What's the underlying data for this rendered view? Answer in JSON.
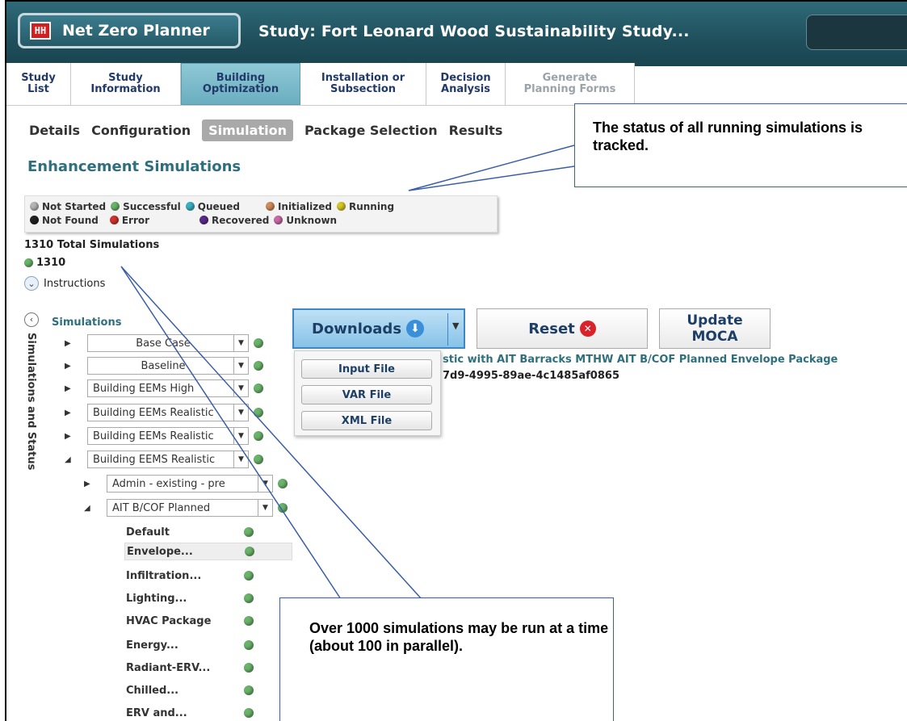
{
  "app": {
    "logo_text": "HH",
    "title": "Net Zero Planner",
    "study_title": "Study: Fort Leonard Wood Sustainability Study..."
  },
  "tabs": [
    {
      "line1": "Study",
      "line2": "List"
    },
    {
      "line1": "Study",
      "line2": "Information"
    },
    {
      "line1": "Building",
      "line2": "Optimization"
    },
    {
      "line1": "Installation or",
      "line2": "Subsection"
    },
    {
      "line1": "Decision",
      "line2": "Analysis"
    },
    {
      "line1": "Generate",
      "line2": "Planning Forms"
    }
  ],
  "subtabs": [
    "Details",
    "Configuration",
    "Simulation",
    "Package Selection",
    "Results"
  ],
  "section_title": "Enhancement Simulations",
  "legend": {
    "not_started": "Not Started",
    "successful": "Successful",
    "queued": "Queued",
    "initialized": "Initialized",
    "running": "Running",
    "not_found": "Not Found",
    "error": "Error",
    "recovered": "Recovered",
    "unknown": "Unknown"
  },
  "colors": {
    "not_started": "#b5b5b5",
    "successful": "#6ab36a",
    "queued": "#3bb0c0",
    "initialized": "#d08a5c",
    "running": "#d6c52a",
    "not_found": "#222222",
    "error": "#d0332c",
    "recovered": "#5a2a8a",
    "unknown": "#c86aa6"
  },
  "total_label": "1310 Total Simulations",
  "success_count": "1310",
  "instructions_label": "Instructions",
  "collapse_glyph": "‹",
  "expand_glyph": "⌄",
  "side_label": "Simulations and Status",
  "simulations_title": "Simulations",
  "tree": [
    "Base Case",
    "Baseline",
    "Building EEMs High",
    "Building EEMs Realistic",
    "Building EEMs Realistic",
    "Building EEMS Realistic",
    "Admin - existing - pre",
    "AIT B/COF Planned"
  ],
  "leaves": [
    "Default",
    "Envelope...",
    "Infiltration...",
    "Lighting...",
    "HVAC Package",
    "Energy...",
    "Radiant-ERV...",
    "Chilled...",
    "ERV and..."
  ],
  "buttons": {
    "downloads": "Downloads",
    "reset": "Reset",
    "update_line1": "Update",
    "update_line2": "MOCA"
  },
  "download_menu": [
    "Input File",
    "VAR File",
    "XML File"
  ],
  "detail": {
    "line1": "stic with AIT Barracks MTHW AIT B/COF Planned Envelope Package",
    "line2": "7d9-4995-89ae-4c1485af0865"
  },
  "callouts": {
    "top": "The status of all running simulations is tracked.",
    "bottom": "Over 1000 simulations may be run at a time (about 100 in parallel)."
  }
}
